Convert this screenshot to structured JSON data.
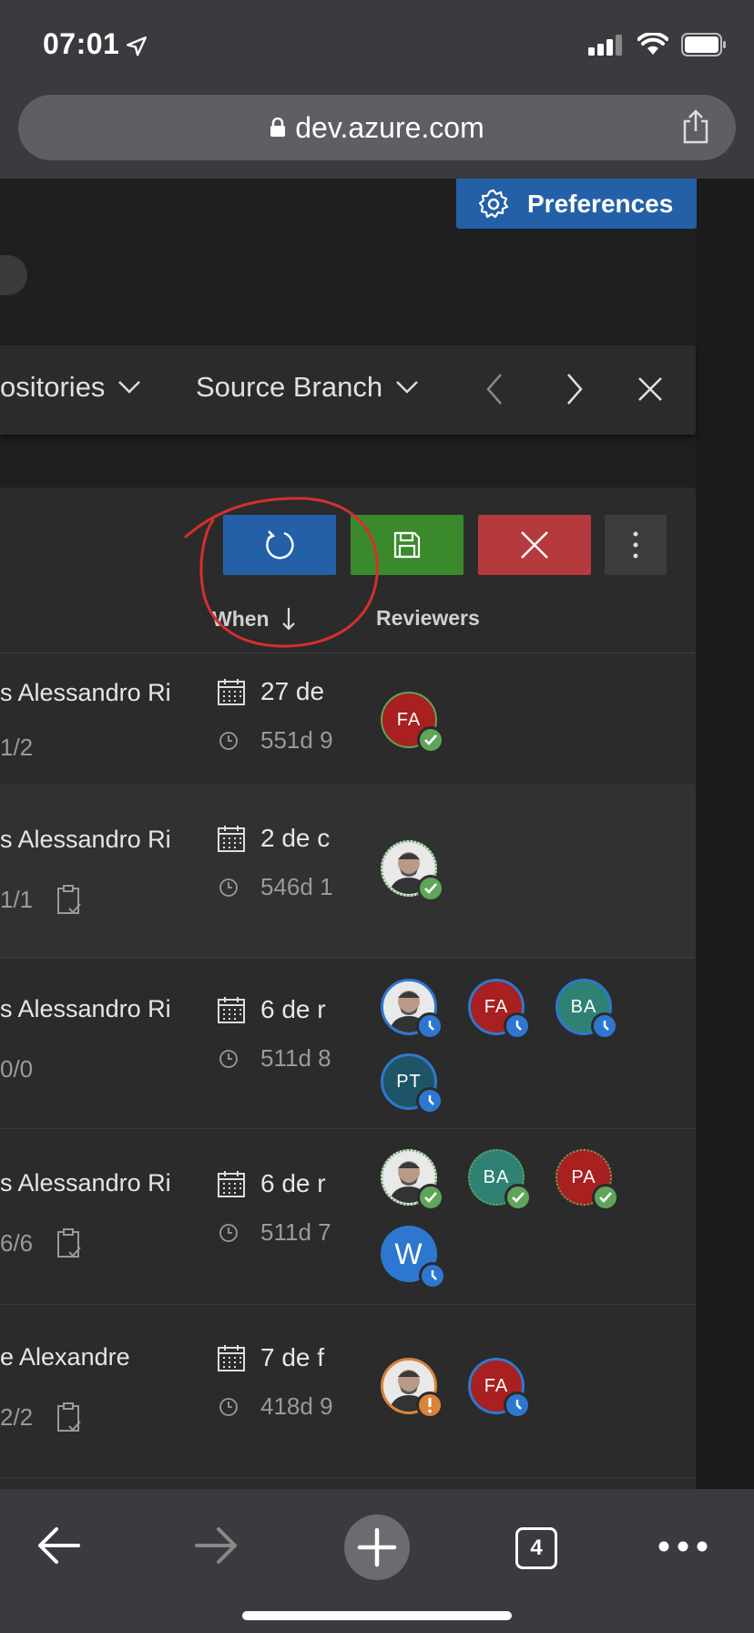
{
  "status_bar": {
    "time": "07:01"
  },
  "browser": {
    "url": "dev.azure.com",
    "tab_count": "4"
  },
  "header": {
    "preferences_label": "Preferences"
  },
  "filters": {
    "repositories_label": "ositories",
    "source_branch_label": "Source Branch"
  },
  "toolbar": {
    "refresh_icon": "refresh-icon",
    "save_icon": "save-icon",
    "clear_icon": "close-icon",
    "more_icon": "more-vertical-icon"
  },
  "columns": {
    "when": "When",
    "reviewers": "Reviewers"
  },
  "rows": [
    {
      "title": "s Alessandro Ri",
      "count": "1/2",
      "date": "27 de",
      "ago": "551d 9"
    },
    {
      "title": "s Alessandro Ri",
      "count": "1/1",
      "date": "2 de c",
      "ago": "546d 1"
    },
    {
      "title": "s Alessandro Ri",
      "count": "0/0",
      "date": "6 de r",
      "ago": "511d 8"
    },
    {
      "title": "s Alessandro Ri",
      "count": "6/6",
      "date": "6 de r",
      "ago": "511d 7"
    },
    {
      "title": "e Alexandre",
      "count": "2/2",
      "date": "7 de f",
      "ago": "418d 9"
    }
  ],
  "reviewers": {
    "fa": "FA",
    "ba": "BA",
    "pt": "PT",
    "pa": "PA",
    "w": "W"
  },
  "colors": {
    "primary_blue": "#2360a8",
    "save_green": "#3a8a2c",
    "clear_red": "#b43a3e",
    "approved_green": "#5ea55a",
    "waiting_blue": "#2e77d0",
    "warning_orange": "#d8843a"
  }
}
